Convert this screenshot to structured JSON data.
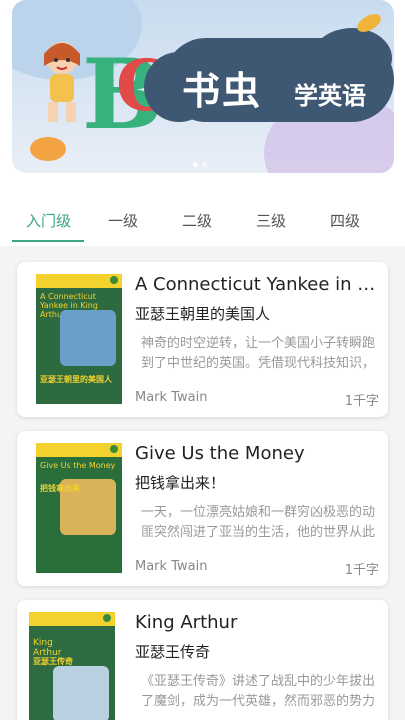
{
  "banner": {
    "title_main": "书虫",
    "title_sub": "学英语",
    "letters": [
      "B",
      "C"
    ]
  },
  "tabs": [
    {
      "label": "入门级",
      "active": true
    },
    {
      "label": "一级",
      "active": false
    },
    {
      "label": "二级",
      "active": false
    },
    {
      "label": "三级",
      "active": false
    },
    {
      "label": "四级",
      "active": false
    }
  ],
  "books": [
    {
      "title_en": "A Connecticut Yankee in King Arthur's Court",
      "title_cn": "亚瑟王朝里的美国人",
      "description": "神奇的时空逆转，让一个美国小子转瞬跑到了中世纪的英国。凭借现代科技知识，他在亚瑟王朝里掀起了一场轩然大波。",
      "author": "Mark Twain",
      "words": "1千字",
      "cover_title": "A Connecticut Yankee in King Arthur's Court",
      "cover_cn": "亚瑟王朝里的美国人",
      "cover_color": "#2e6a3f"
    },
    {
      "title_en": "Give Us the Money",
      "title_cn": "把钱拿出来！",
      "description": "一天，一位漂亮姑娘和一群穷凶极恶的动匪突然闯进了亚当的生活，他的世界从此变得惊心动魄。",
      "author": "Mark Twain",
      "words": "1千字",
      "cover_title": "Give Us the Money",
      "cover_cn": "把钱拿出来",
      "cover_color": "#2a6e3c"
    },
    {
      "title_en": "King Arthur",
      "title_cn": "亚瑟王传奇",
      "description": "《亚瑟王传奇》讲述了战乱中的少年拔出了魔剑，成为一代英雄，然而邪恶的势力正在悄悄逼近。",
      "author": "",
      "words": "",
      "cover_title": "King Arthur",
      "cover_cn": "亚瑟王传奇",
      "cover_color": "#2f6b41"
    }
  ],
  "colors": {
    "accent": "#3aa781",
    "banner_cloud": "#3e5873"
  }
}
